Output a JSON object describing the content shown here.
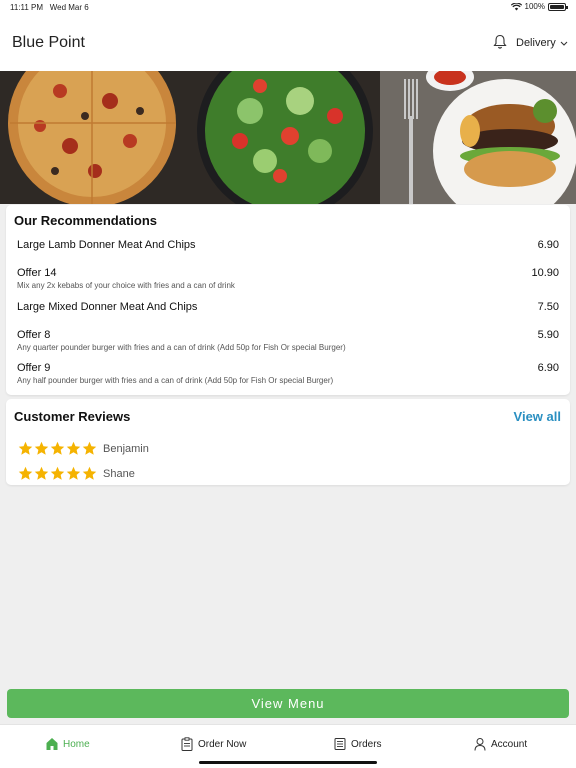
{
  "status_bar": {
    "time": "11:11 PM",
    "date": "Wed Mar 6",
    "battery": "100%",
    "battery_level": 1.0
  },
  "header": {
    "title": "Blue Point",
    "order_mode": "Delivery",
    "icons": [
      "bell-icon",
      "chevron-down-icon"
    ]
  },
  "hero": {
    "icons": [
      "pizza-photo",
      "salad-photo",
      "burger-photo",
      "fork-icon"
    ]
  },
  "recommendations": {
    "title": "Our Recommendations",
    "items": [
      {
        "name": "Large Lamb Donner Meat And Chips",
        "description": "",
        "price": "6.90"
      },
      {
        "name": "Offer 14",
        "description": "Mix any 2x kebabs of your choice with fries and a can of drink",
        "price": "10.90"
      },
      {
        "name": "Large Mixed Donner Meat And Chips",
        "description": "",
        "price": "7.50"
      },
      {
        "name": "Offer 8",
        "description": "Any quarter pounder burger with fries and a can of drink (Add 50p for Fish Or special Burger)",
        "price": "5.90"
      },
      {
        "name": "Offer 9",
        "description": "Any half pounder burger with fries and a can of drink (Add 50p for Fish Or special Burger)",
        "price": "6.90"
      }
    ]
  },
  "reviews": {
    "title": "Customer Reviews",
    "view_all": "View all",
    "items": [
      {
        "name": "Benjamin",
        "rating": 5
      },
      {
        "name": "Shane",
        "rating": 5
      }
    ]
  },
  "view_menu_label": "View Menu",
  "tabs": [
    {
      "label": "Home",
      "icon": "home-icon",
      "active": true
    },
    {
      "label": "Order Now",
      "icon": "clipboard-icon",
      "active": false
    },
    {
      "label": "Orders",
      "icon": "receipt-icon",
      "active": false
    },
    {
      "label": "Account",
      "icon": "user-icon",
      "active": false
    }
  ],
  "colors": {
    "accent_green": "#5cb85c",
    "link_blue": "#2a8fc1",
    "star_gold": "#f5b301"
  }
}
